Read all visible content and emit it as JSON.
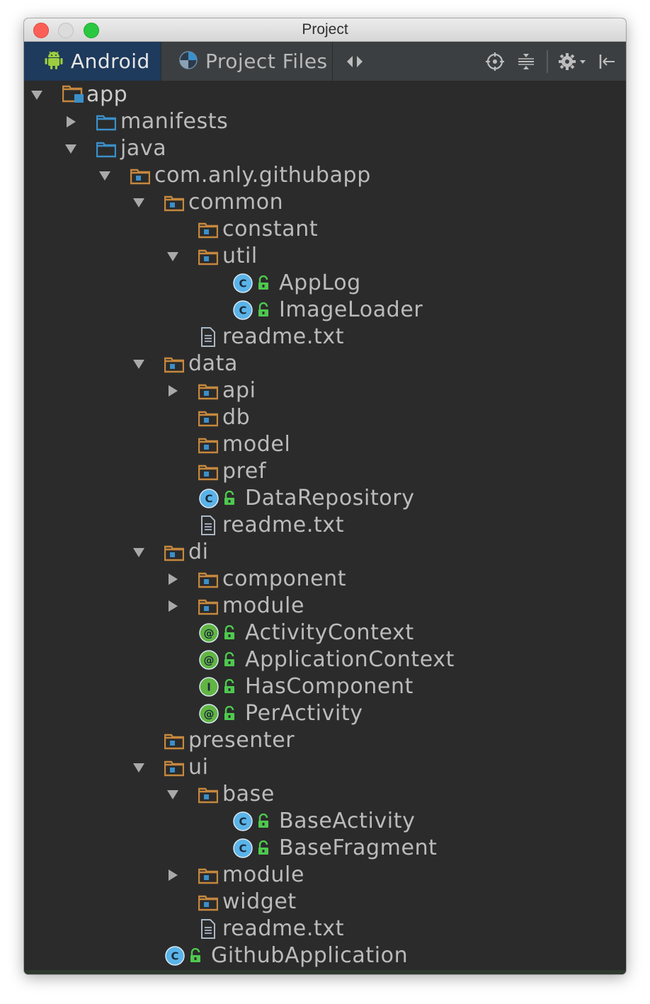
{
  "window": {
    "title": "Project"
  },
  "toolbar": {
    "tabs": [
      {
        "label": "Android",
        "icon": "android-icon",
        "selected": true
      },
      {
        "label": "Project Files",
        "icon": "project-files-icon",
        "selected": false
      }
    ],
    "actions": [
      "split-arrows-icon",
      "locate-icon",
      "collapse-all-icon",
      "gear-icon",
      "hide-panel-icon"
    ]
  },
  "tree": [
    {
      "label": "app",
      "type": "module",
      "depth": 0,
      "arrow": "down"
    },
    {
      "label": "manifests",
      "type": "folder",
      "depth": 1,
      "arrow": "right"
    },
    {
      "label": "java",
      "type": "folder",
      "depth": 1,
      "arrow": "down"
    },
    {
      "label": "com.anly.githubapp",
      "type": "package",
      "depth": 2,
      "arrow": "down"
    },
    {
      "label": "common",
      "type": "package",
      "depth": 3,
      "arrow": "down"
    },
    {
      "label": "constant",
      "type": "package",
      "depth": 4,
      "arrow": "none"
    },
    {
      "label": "util",
      "type": "package",
      "depth": 4,
      "arrow": "down"
    },
    {
      "label": "AppLog",
      "type": "class",
      "depth": 5,
      "arrow": "none"
    },
    {
      "label": "ImageLoader",
      "type": "class",
      "depth": 5,
      "arrow": "none"
    },
    {
      "label": "readme.txt",
      "type": "file",
      "depth": 4,
      "arrow": "none"
    },
    {
      "label": "data",
      "type": "package",
      "depth": 3,
      "arrow": "down"
    },
    {
      "label": "api",
      "type": "package",
      "depth": 4,
      "arrow": "right"
    },
    {
      "label": "db",
      "type": "package",
      "depth": 4,
      "arrow": "none"
    },
    {
      "label": "model",
      "type": "package",
      "depth": 4,
      "arrow": "none"
    },
    {
      "label": "pref",
      "type": "package",
      "depth": 4,
      "arrow": "none"
    },
    {
      "label": "DataRepository",
      "type": "class",
      "depth": 4,
      "arrow": "none"
    },
    {
      "label": "readme.txt",
      "type": "file",
      "depth": 4,
      "arrow": "none"
    },
    {
      "label": "di",
      "type": "package",
      "depth": 3,
      "arrow": "down"
    },
    {
      "label": "component",
      "type": "package",
      "depth": 4,
      "arrow": "right"
    },
    {
      "label": "module",
      "type": "package",
      "depth": 4,
      "arrow": "right"
    },
    {
      "label": "ActivityContext",
      "type": "annotation",
      "depth": 4,
      "arrow": "none"
    },
    {
      "label": "ApplicationContext",
      "type": "annotation",
      "depth": 4,
      "arrow": "none"
    },
    {
      "label": "HasComponent",
      "type": "interface",
      "depth": 4,
      "arrow": "none"
    },
    {
      "label": "PerActivity",
      "type": "annotation",
      "depth": 4,
      "arrow": "none"
    },
    {
      "label": "presenter",
      "type": "package",
      "depth": 3,
      "arrow": "none"
    },
    {
      "label": "ui",
      "type": "package",
      "depth": 3,
      "arrow": "down"
    },
    {
      "label": "base",
      "type": "package",
      "depth": 4,
      "arrow": "down"
    },
    {
      "label": "BaseActivity",
      "type": "class",
      "depth": 5,
      "arrow": "none"
    },
    {
      "label": "BaseFragment",
      "type": "class",
      "depth": 5,
      "arrow": "none"
    },
    {
      "label": "module",
      "type": "package",
      "depth": 4,
      "arrow": "right"
    },
    {
      "label": "widget",
      "type": "package",
      "depth": 4,
      "arrow": "none"
    },
    {
      "label": "readme.txt",
      "type": "file",
      "depth": 4,
      "arrow": "none"
    },
    {
      "label": "GithubApplication",
      "type": "class",
      "depth": 3,
      "arrow": "none"
    }
  ],
  "colors": {
    "background": "#2b2b2b",
    "toolbar": "#3c3f41",
    "selected_tab": "#1e3a5c",
    "text": "#bbbbbb",
    "folder_orange": "#c5883e",
    "folder_blue": "#3b8fc9",
    "class_blue": "#5ab3e8",
    "annotation_green": "#62b543",
    "lock_green": "#4ec94e"
  }
}
